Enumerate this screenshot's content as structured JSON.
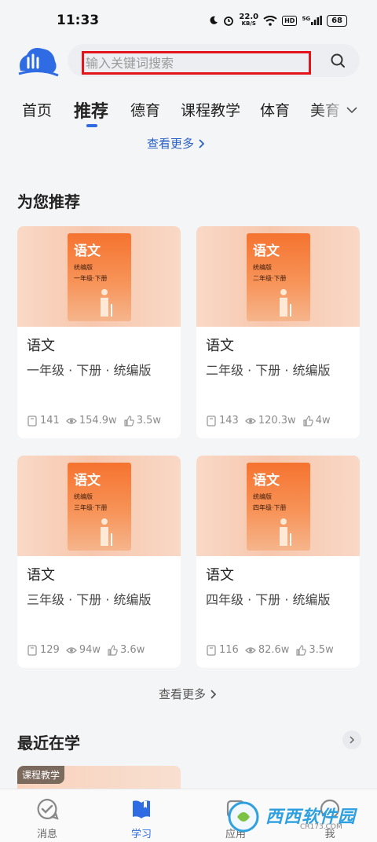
{
  "status_bar": {
    "time": "11:33",
    "speed_value": "22.0",
    "speed_unit": "KB/S",
    "hd": "HD",
    "net": "5G",
    "battery": "68"
  },
  "header": {
    "search_placeholder": "输入关键词搜索"
  },
  "tabs": [
    {
      "label": "首页",
      "active": false
    },
    {
      "label": "推荐",
      "active": true
    },
    {
      "label": "德育",
      "active": false
    },
    {
      "label": "课程教学",
      "active": false
    },
    {
      "label": "体育",
      "active": false
    },
    {
      "label": "美育",
      "active": false
    }
  ],
  "top_more": "查看更多",
  "recommend": {
    "title": "为您推荐",
    "cards": [
      {
        "book_title": "语文",
        "book_edition": "统编版",
        "book_grade": "一年级·下册",
        "name": "语文",
        "sub": "一年级 · 下册 · 统编版",
        "lessons": "141",
        "views": "154.9w",
        "likes": "3.5w"
      },
      {
        "book_title": "语文",
        "book_edition": "统编版",
        "book_grade": "二年级·下册",
        "name": "语文",
        "sub": "二年级 · 下册 · 统编版",
        "lessons": "143",
        "views": "120.3w",
        "likes": "4w"
      },
      {
        "book_title": "语文",
        "book_edition": "统编版",
        "book_grade": "三年级·下册",
        "name": "语文",
        "sub": "三年级 · 下册 · 统编版",
        "lessons": "129",
        "views": "94w",
        "likes": "3.6w"
      },
      {
        "book_title": "语文",
        "book_edition": "统编版",
        "book_grade": "四年级·下册",
        "name": "语文",
        "sub": "四年级 · 下册 · 统编版",
        "lessons": "116",
        "views": "82.6w",
        "likes": "3.5w"
      }
    ],
    "more": "查看更多"
  },
  "recent": {
    "title": "最近在学",
    "badge": "课程教学"
  },
  "bottom_nav": [
    {
      "label": "消息",
      "icon": "message-check-icon",
      "active": false
    },
    {
      "label": "学习",
      "icon": "book-icon",
      "active": true
    },
    {
      "label": "应用",
      "icon": "apps-icon",
      "active": false
    },
    {
      "label": "我",
      "icon": "profile-icon",
      "active": false
    }
  ],
  "watermark": {
    "text": "西西软件园",
    "url": "CR173.COM"
  },
  "colors": {
    "accent": "#2f6be3",
    "link": "#2b62c7",
    "highlight_border": "#e3141c",
    "book_orange": "#f5732f"
  }
}
